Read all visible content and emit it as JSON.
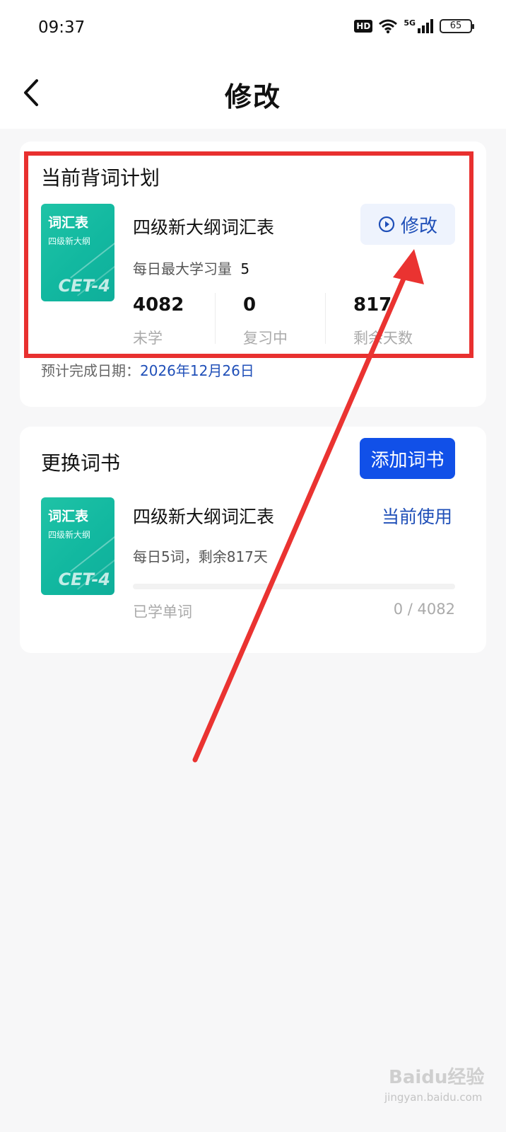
{
  "status_bar": {
    "time": "09:37",
    "hd": "HD",
    "network": "5G",
    "battery": "65"
  },
  "header": {
    "title": "修改",
    "back_icon": "chevron-left-icon"
  },
  "plan": {
    "section_title": "当前背词计划",
    "cover": {
      "title": "词汇表",
      "subtitle": "四级新大纲",
      "badge": "CET-4"
    },
    "book_name": "四级新大纲词汇表",
    "daily_max_label": "每日最大学习量",
    "daily_max_value": "5",
    "modify_button": "修改",
    "modify_icon": "play-circle-icon",
    "stats": [
      {
        "value": "4082",
        "label": "未学"
      },
      {
        "value": "0",
        "label": "复习中"
      },
      {
        "value": "817",
        "label": "剩余天数"
      }
    ],
    "finish_label": "预计完成日期：",
    "finish_date": "2026年12月26日"
  },
  "books": {
    "section_title": "更换词书",
    "add_button": "添加词书",
    "items": [
      {
        "cover": {
          "title": "词汇表",
          "subtitle": "四级新大纲",
          "badge": "CET-4"
        },
        "name": "四级新大纲词汇表",
        "status": "当前使用",
        "detail": "每日5词，剩余817天",
        "progress_label": "已学单词",
        "progress_count": "0 / 4082",
        "progress_fraction": 0
      }
    ]
  },
  "watermark": {
    "text": "Baidu经验",
    "sub": "jingyan.baidu.com"
  },
  "colors": {
    "accent": "#1150e8",
    "link": "#1f4fb8",
    "highlight_frame": "#e8302f",
    "cover": "#14bba2"
  }
}
